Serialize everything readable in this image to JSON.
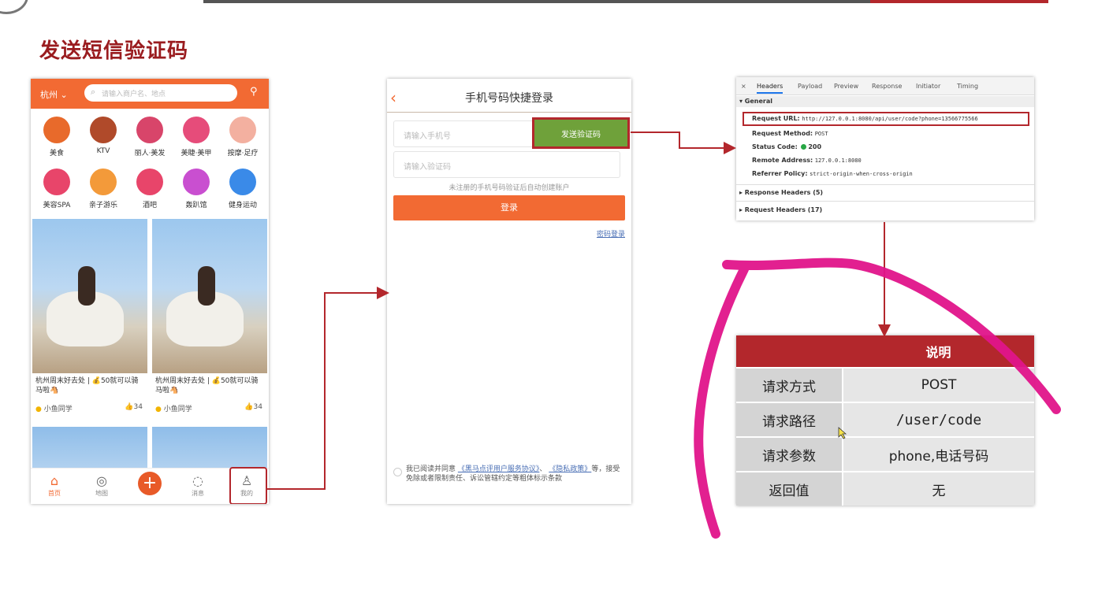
{
  "slide": {
    "title": "发送短信验证码"
  },
  "phone1": {
    "city": "杭州",
    "search_placeholder": "请输入商户名、地点",
    "categories": [
      {
        "label": "美食",
        "color": "#e86a2b"
      },
      {
        "label": "KTV",
        "color": "#b04a2a"
      },
      {
        "label": "丽人·美发",
        "color": "#d8456a"
      },
      {
        "label": "美睫·美甲",
        "color": "#e64c7a"
      },
      {
        "label": "按摩·足疗",
        "color": "#f3b0a0"
      },
      {
        "label": "美容SPA",
        "color": "#e8456a"
      },
      {
        "label": "亲子游乐",
        "color": "#f39a3a"
      },
      {
        "label": "酒吧",
        "color": "#e8456a"
      },
      {
        "label": "轰趴馆",
        "color": "#c94fd0"
      },
      {
        "label": "健身运动",
        "color": "#3a8ae8"
      }
    ],
    "cards": [
      {
        "title": "杭州周末好去处 | 💰50就可以骑马啦🐴",
        "author": "小鱼同学",
        "likes": "34"
      },
      {
        "title": "杭州周末好去处 | 💰50就可以骑马啦🐴",
        "author": "小鱼同学",
        "likes": "34"
      }
    ],
    "tabs": [
      {
        "label": "首页",
        "icon": "home-icon"
      },
      {
        "label": "地图",
        "icon": "map-icon"
      },
      {
        "label": "",
        "icon": "plus-icon"
      },
      {
        "label": "消息",
        "icon": "message-icon"
      },
      {
        "label": "我的",
        "icon": "user-icon"
      }
    ]
  },
  "phone2": {
    "title": "手机号码快捷登录",
    "phone_placeholder": "请输入手机号",
    "send_code_label": "发送验证码",
    "code_placeholder": "请输入验证码",
    "hint": "未注册的手机号码验证后自动创建账户",
    "login_label": "登录",
    "password_login": "密码登录",
    "agree_prefix": "我已阅读并同意",
    "agree_link1": "《黑马点评用户服务协议》",
    "agree_sep": "、",
    "agree_link2": "《隐私政策》",
    "agree_suffix": "等，接受免除或者限制责任、诉讼管辖约定等粗体标示条款"
  },
  "devtools": {
    "tabs": [
      "Headers",
      "Payload",
      "Preview",
      "Response",
      "Initiator",
      "Timing"
    ],
    "close": "×",
    "general": "▾ General",
    "rows": [
      {
        "label": "Request URL:",
        "value": "http://127.0.0.1:8080/api/user/code?phone=13566775566"
      },
      {
        "label": "Request Method:",
        "value": "POST"
      },
      {
        "label": "Status Code:",
        "value": "200"
      },
      {
        "label": "Remote Address:",
        "value": "127.0.0.1:8080"
      },
      {
        "label": "Referrer Policy:",
        "value": "strict-origin-when-cross-origin"
      }
    ],
    "response_headers": "▸ Response Headers (5)",
    "request_headers": "▸ Request Headers (17)"
  },
  "table": {
    "header": "说明",
    "rows": [
      {
        "key": "请求方式",
        "value": "POST"
      },
      {
        "key": "请求路径",
        "value": "/user/code"
      },
      {
        "key": "请求参数",
        "value": "phone,电话号码"
      },
      {
        "key": "返回值",
        "value": "无"
      }
    ]
  },
  "colors": {
    "accent": "#b3272c",
    "brand_orange": "#f26a33",
    "send_green": "#6fa13a",
    "annotation_pink": "#e0148a"
  }
}
